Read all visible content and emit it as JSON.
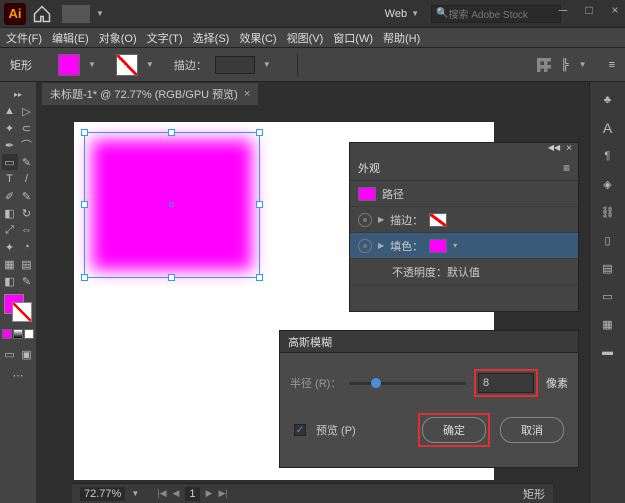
{
  "titlebar": {
    "workspace": "Web",
    "search_placeholder": "搜索 Adobe Stock"
  },
  "menubar": {
    "file": "文件(F)",
    "edit": "编辑(E)",
    "object": "对象(O)",
    "type": "文字(T)",
    "select": "选择(S)",
    "effect": "效果(C)",
    "view": "视图(V)",
    "window": "窗口(W)",
    "help": "帮助(H)"
  },
  "controlbar": {
    "shape": "矩形",
    "stroke_label": "描边："
  },
  "doc_tab": {
    "title": "未标题-1* @ 72.77% (RGB/GPU 预览)",
    "close": "×"
  },
  "appearance": {
    "title": "外观",
    "path_label": "路径",
    "stroke_label": "描边：",
    "fill_label": "填色：",
    "opacity_label": "不透明度：默认值"
  },
  "blur_dialog": {
    "title": "高斯模糊",
    "radius_label": "半径 (R)：",
    "radius_value": "8",
    "px_label": "像素",
    "preview_label": "预览 (P)",
    "ok": "确定",
    "cancel": "取消"
  },
  "statusbar": {
    "zoom": "72.77%",
    "shape": "矩形"
  }
}
